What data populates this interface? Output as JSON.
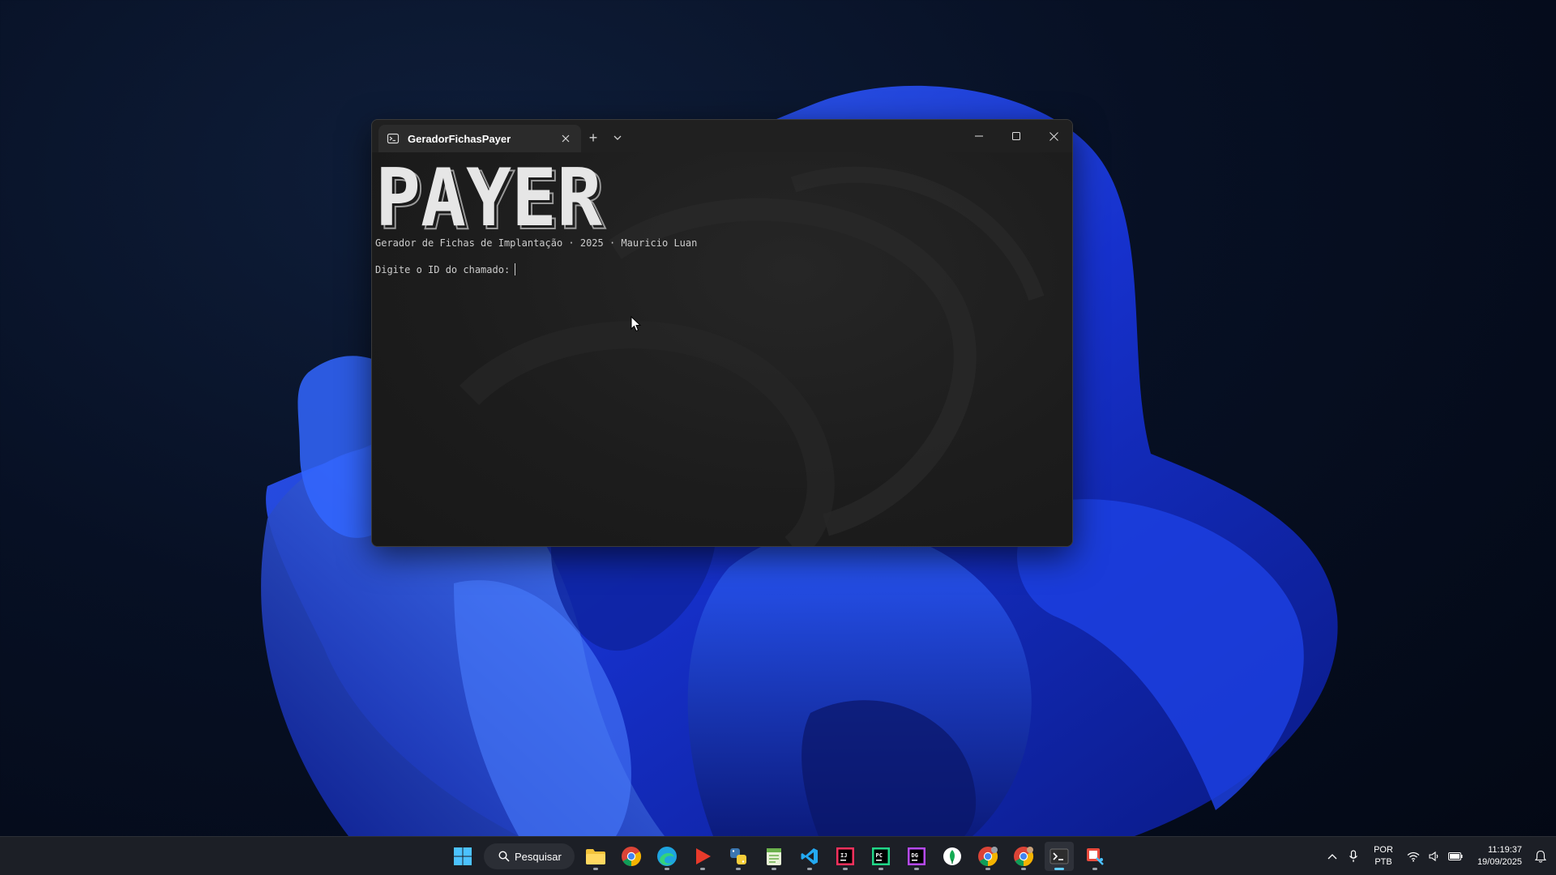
{
  "window": {
    "tab_title": "GeradorFichasPayer",
    "new_tab_symbol": "+",
    "dropdown_symbol": "⌄",
    "minimize_icon": "minimize-icon",
    "maximize_icon": "maximize-icon",
    "close_icon": "close-icon"
  },
  "terminal": {
    "banner_text": "PAYER",
    "subtitle": "Gerador de Fichas de Implantação · 2025 · Mauricio Luan",
    "prompt": "Digite o ID do chamado:"
  },
  "taskbar": {
    "search_label": "Pesquisar",
    "apps": [
      {
        "name": "start",
        "icon": "windows-icon"
      },
      {
        "name": "file-explorer",
        "icon": "folder-icon"
      },
      {
        "name": "chrome",
        "icon": "chrome-icon"
      },
      {
        "name": "edge",
        "icon": "edge-icon"
      },
      {
        "name": "media-player",
        "icon": "play-icon"
      },
      {
        "name": "python-app",
        "icon": "python-icon"
      },
      {
        "name": "notepad",
        "icon": "notepad-icon"
      },
      {
        "name": "vscode",
        "icon": "vscode-icon"
      },
      {
        "name": "intellij",
        "icon": "intellij-icon"
      },
      {
        "name": "pycharm",
        "icon": "pycharm-icon"
      },
      {
        "name": "datagrip",
        "icon": "datagrip-icon"
      },
      {
        "name": "mongodb-compass",
        "icon": "leaf-icon"
      },
      {
        "name": "chrome-profile-1",
        "icon": "chrome-icon"
      },
      {
        "name": "chrome-profile-2",
        "icon": "chrome-icon"
      },
      {
        "name": "terminal",
        "icon": "terminal-icon"
      },
      {
        "name": "snipping-tool",
        "icon": "snipping-icon"
      }
    ],
    "language_top": "POR",
    "language_bottom": "PTB",
    "time": "11:19:37",
    "date": "19/09/2025"
  },
  "colors": {
    "accent": "#60cdff",
    "terminal_bg": "#1f1f1f",
    "wallpaper_blue": "#1a4bff"
  }
}
